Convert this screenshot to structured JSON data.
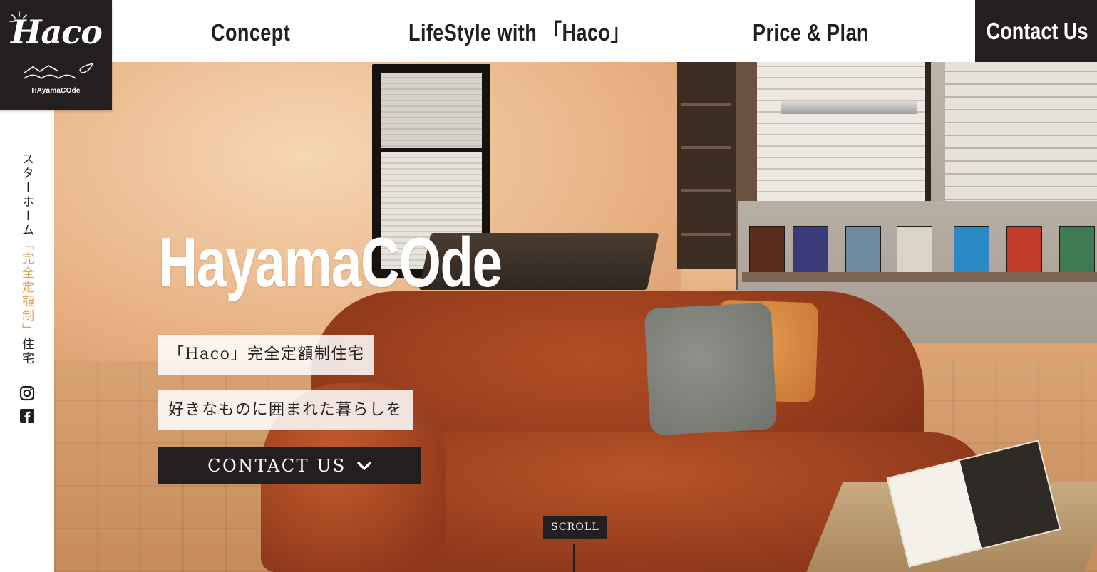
{
  "logo": {
    "wordmark": "Haco",
    "subtitle": "HAyamaCOde"
  },
  "nav": {
    "items": [
      {
        "label": "Concept"
      },
      {
        "label": "LifeStyle with 「Haco」"
      },
      {
        "label": "Price & Plan"
      }
    ],
    "contact_label": "Contact Us"
  },
  "side": {
    "text_before": "スターホーム",
    "text_highlight": "「完全定額制」",
    "text_after": "住宅",
    "highlight_color": "#e3a35f",
    "social": [
      "instagram-icon",
      "facebook-icon"
    ]
  },
  "hero": {
    "title": "HayamaCOde",
    "tagline_1": "「Haco」完全定額制住宅",
    "tagline_2": "好きなものに囲まれた暮らしを",
    "cta_label": "CONTACT US",
    "cta_icon": "chevron-down-icon",
    "scroll_label": "SCROLL"
  },
  "colors": {
    "dark": "#231f20",
    "accent": "#e3a35f",
    "white": "#ffffff"
  }
}
